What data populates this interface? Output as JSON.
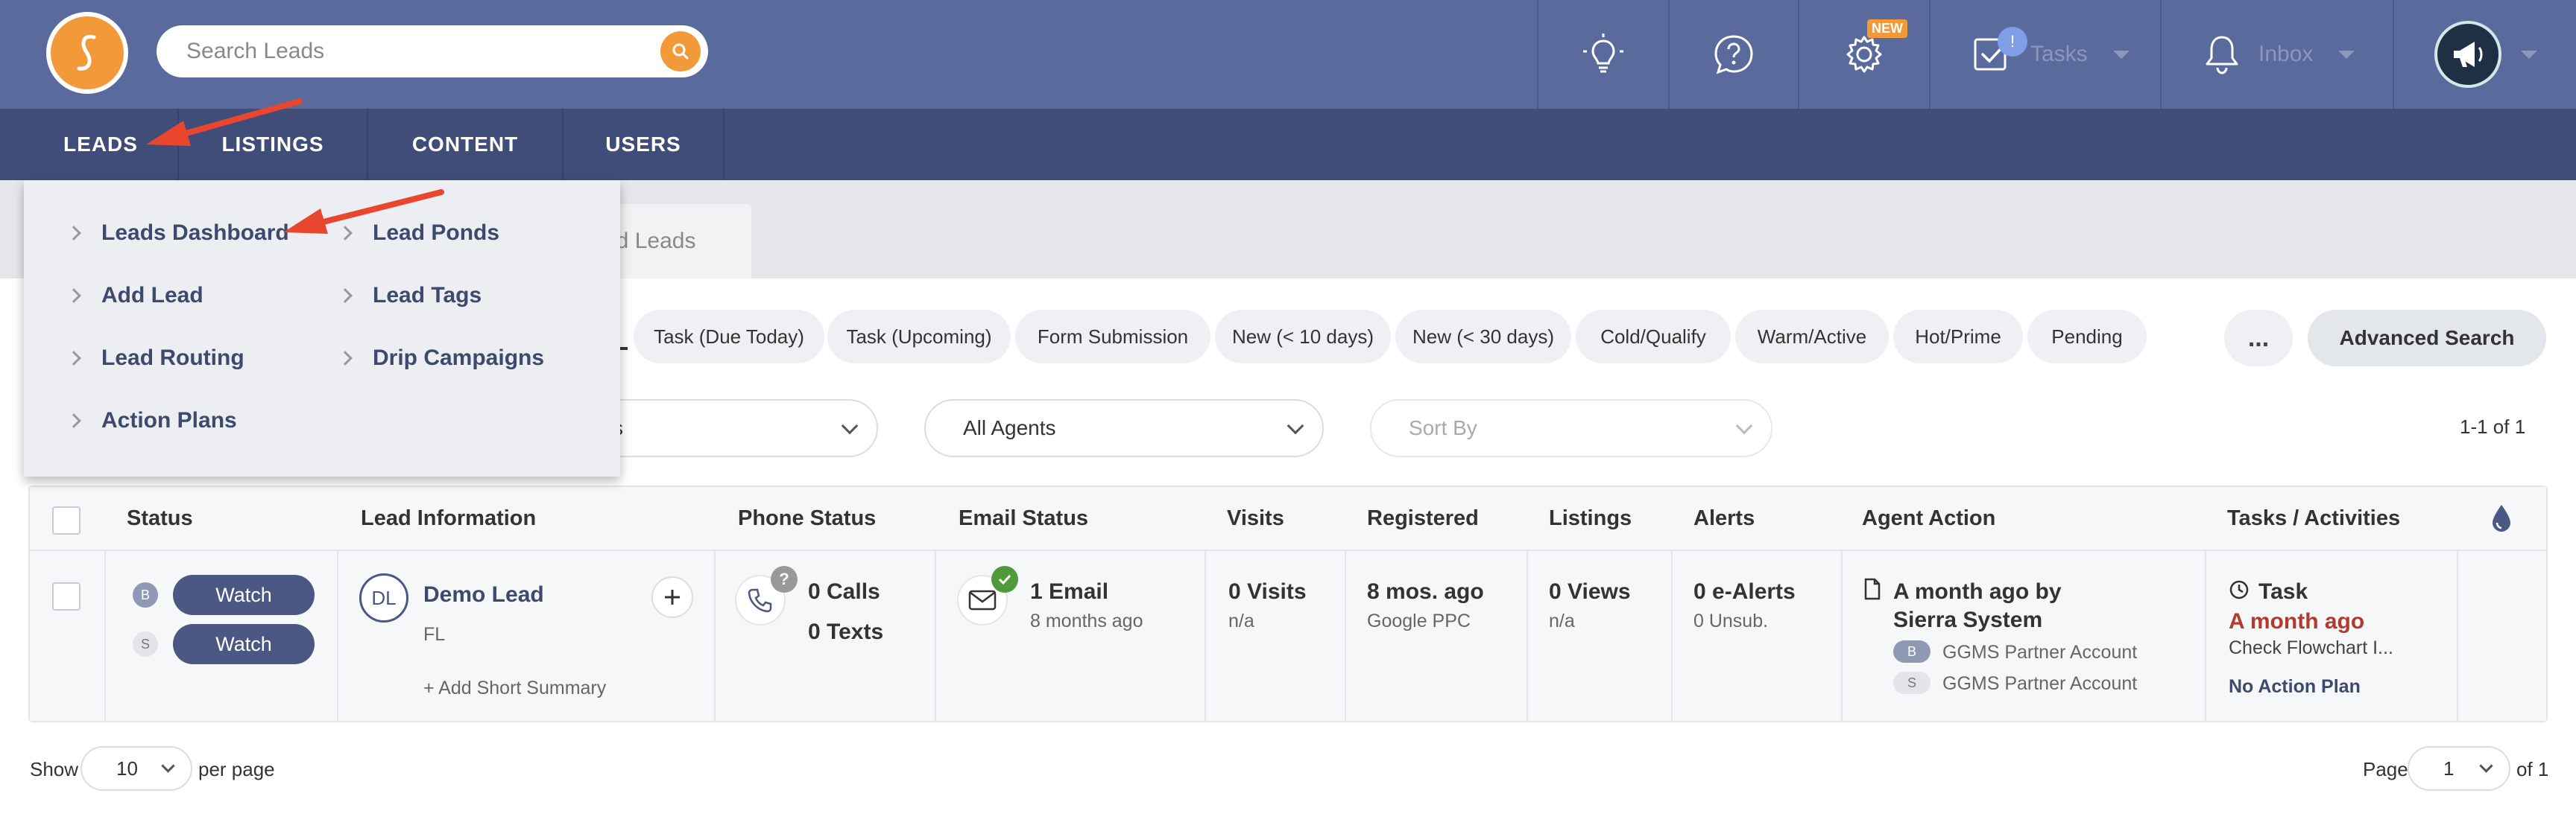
{
  "header": {
    "search_placeholder": "Search Leads",
    "tasks_label": "Tasks",
    "tasks_badge": "!",
    "inbox_label": "Inbox",
    "new_badge": "NEW"
  },
  "nav": {
    "items": [
      {
        "label": "LEADS"
      },
      {
        "label": "LISTINGS"
      },
      {
        "label": "CONTENT"
      },
      {
        "label": "USERS"
      }
    ]
  },
  "leads_menu": {
    "col1": [
      {
        "label": "Leads Dashboard"
      },
      {
        "label": "Add Lead"
      },
      {
        "label": "Lead Routing"
      },
      {
        "label": "Action Plans"
      }
    ],
    "col2": [
      {
        "label": "Lead Ponds"
      },
      {
        "label": "Lead Tags"
      },
      {
        "label": "Drip Campaigns"
      }
    ]
  },
  "tabs": {
    "find_partial": "nd Leads"
  },
  "filters": {
    "pills": [
      {
        "label": "Task (Due Today)"
      },
      {
        "label": "Task (Upcoming)"
      },
      {
        "label": "Form Submission"
      },
      {
        "label": "New (< 10 days)"
      },
      {
        "label": "New (< 30 days)"
      },
      {
        "label": "Cold/Qualify"
      },
      {
        "label": "Warm/Active"
      },
      {
        "label": "Hot/Prime"
      },
      {
        "label": "Pending"
      }
    ],
    "more_label": "...",
    "advanced_search": "Advanced Search",
    "partial_dropdown_text": "s",
    "agents": "All Agents",
    "sort_placeholder": "Sort By",
    "count_text": "1-1 of 1"
  },
  "table": {
    "headers": {
      "status": "Status",
      "lead_info": "Lead Information",
      "phone_status": "Phone Status",
      "email_status": "Email Status",
      "visits": "Visits",
      "registered": "Registered",
      "listings": "Listings",
      "alerts": "Alerts",
      "agent_action": "Agent Action",
      "tasks": "Tasks / Activities"
    },
    "row": {
      "badge_b": "B",
      "badge_s": "S",
      "watch_b": "Watch",
      "watch_s": "Watch",
      "avatar": "DL",
      "lead_name": "Demo Lead",
      "lead_state": "FL",
      "add_summary": "+ Add Short Summary",
      "phone_unknown": "?",
      "calls": "0 Calls",
      "texts": "0 Texts",
      "emails": "1 Email",
      "email_time": "8 months ago",
      "visits": "0 Visits",
      "visits_sub": "n/a",
      "registered": "8 mos. ago",
      "registered_sub": "Google PPC",
      "listings": "0 Views",
      "listings_sub": "n/a",
      "alerts": "0 e-Alerts",
      "alerts_sub": "0 Unsub.",
      "agent_action_line1": "A month ago by",
      "agent_action_line2": "Sierra System",
      "agent_b": "B",
      "agent_b_name": "GGMS Partner Account",
      "agent_s": "S",
      "agent_s_name": "GGMS Partner Account",
      "task_label": "Task",
      "task_time": "A month ago",
      "task_desc": "Check Flowchart I...",
      "action_plan": "No Action Plan"
    }
  },
  "footer": {
    "show": "Show",
    "per_page_value": "10",
    "per_page": "per page",
    "page": "Page",
    "page_value": "1",
    "of": "of 1"
  },
  "colors": {
    "header_bg": "#5a6a9d",
    "nav_bg": "#3f4d78",
    "accent": "#f29a3a",
    "watch_button": "#4a5883",
    "task_red": "#b23a2e",
    "arrow": "#e8462f"
  }
}
